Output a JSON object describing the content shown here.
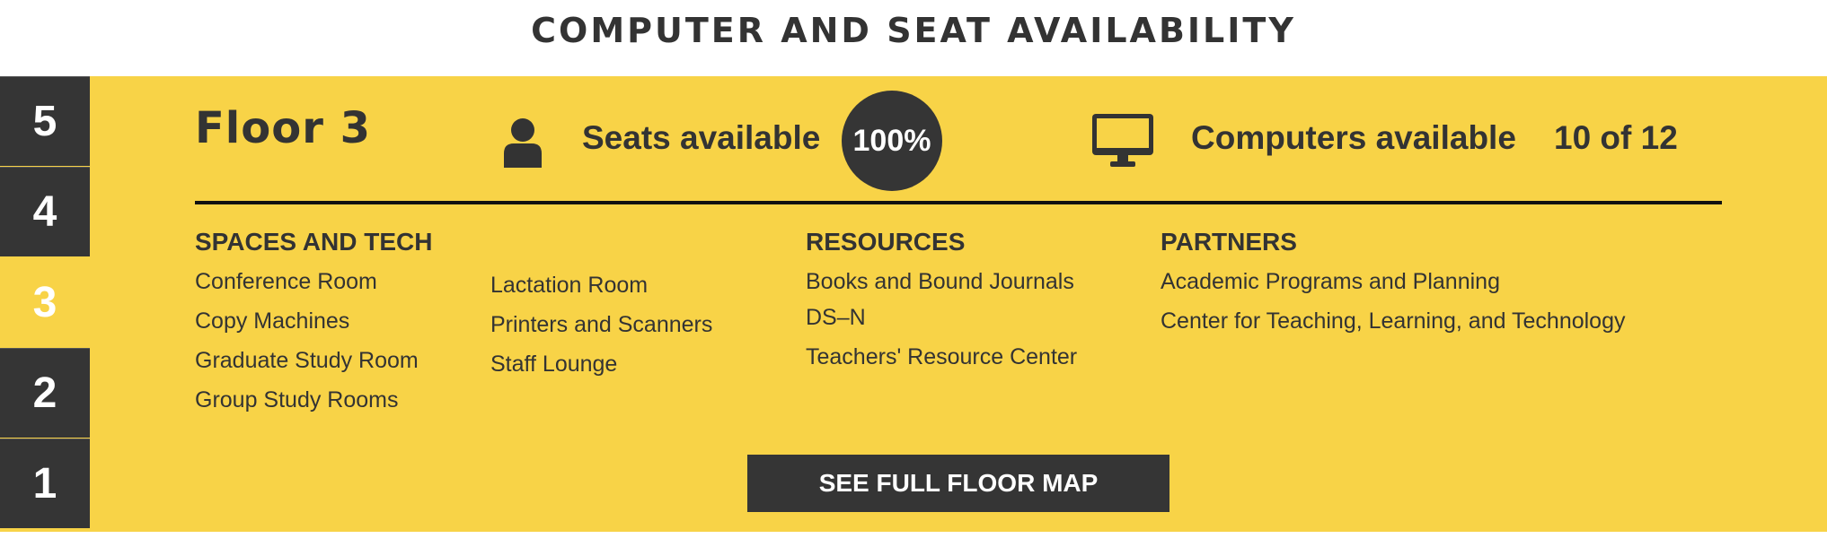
{
  "page": {
    "title": "COMPUTER AND SEAT AVAILABILITY"
  },
  "colors": {
    "panel": "#f8d347",
    "dark": "#353535",
    "active_text": "#ffffff"
  },
  "floor_nav": {
    "tabs": [
      {
        "label": "5",
        "active": false
      },
      {
        "label": "4",
        "active": false
      },
      {
        "label": "3",
        "active": true
      },
      {
        "label": "2",
        "active": false
      },
      {
        "label": "1",
        "active": false
      }
    ]
  },
  "floor": {
    "heading": "Floor 3",
    "seats": {
      "icon": "person-icon",
      "label": "Seats available",
      "value": "100%"
    },
    "computers": {
      "icon": "monitor-icon",
      "label": "Computers available",
      "value": "10 of 12"
    }
  },
  "sections": {
    "spaces": {
      "heading": "SPACES AND TECH",
      "col1": [
        "Conference Room",
        "Copy Machines",
        "Graduate Study Room",
        "Group Study Rooms"
      ],
      "col2": [
        "Lactation Room",
        "Printers and Scanners",
        "Staff Lounge"
      ]
    },
    "resources": {
      "heading": "RESOURCES",
      "items": [
        "Books and Bound Journals",
        "DS–N",
        "Teachers' Resource Center"
      ]
    },
    "partners": {
      "heading": "PARTNERS",
      "items": [
        "Academic Programs and Planning",
        "Center for Teaching, Learning, and Technology"
      ]
    }
  },
  "map_button": {
    "label": "SEE FULL FLOOR MAP"
  }
}
